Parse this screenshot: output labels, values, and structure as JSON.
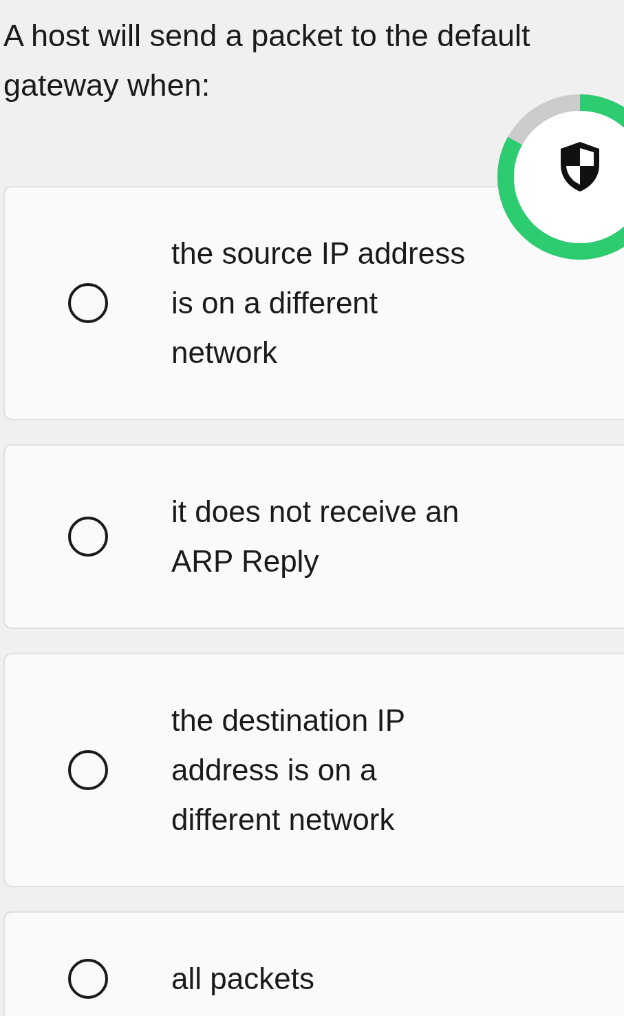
{
  "question": "A host will send a packet to the default gateway when:",
  "options": [
    {
      "text": "the source IP address is on a different network",
      "selected": false
    },
    {
      "text": "it does not receive an ARP Reply",
      "selected": false
    },
    {
      "text": "the destination IP address is on a different network",
      "selected": false
    },
    {
      "text": "all packets",
      "selected": false
    }
  ]
}
